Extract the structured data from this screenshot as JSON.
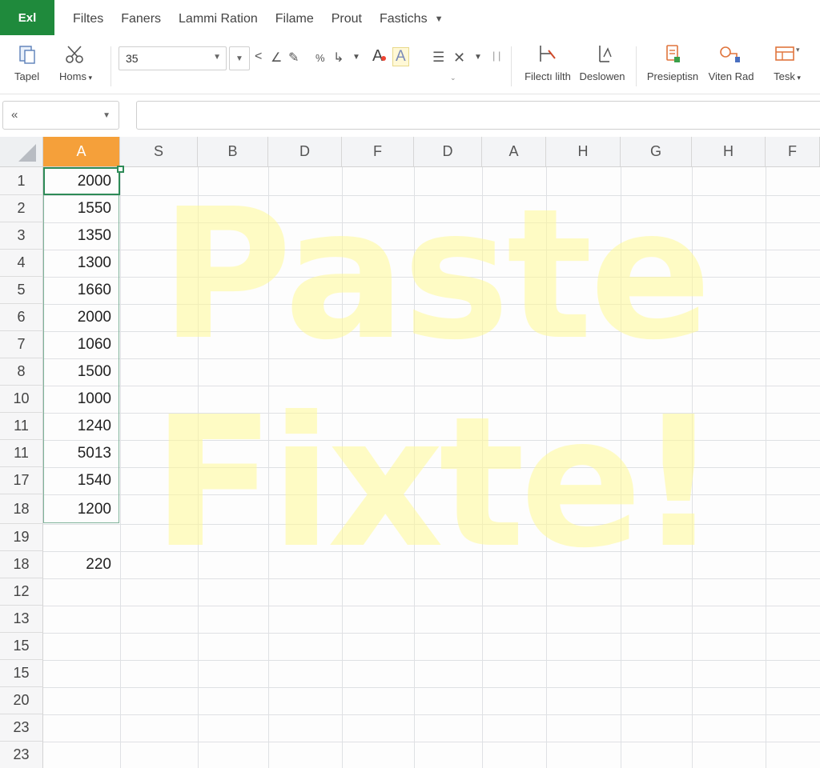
{
  "app": {
    "badge": "Exl"
  },
  "menu": {
    "items": [
      "Filtes",
      "Faners",
      "Lammi Ration",
      "Filame",
      "Prout",
      "Fastichs"
    ]
  },
  "ribbon": {
    "paste_label": "Tapel",
    "home_label": "Homs",
    "font_size": "35",
    "filter_label": "Filectı lilth",
    "deslowen_label": "Deslowen",
    "presiepti_label": "Presiepti",
    "viten_label": "Viten Rad",
    "task_label": "Tesk"
  },
  "namebox": {
    "value": "«"
  },
  "columns": [
    "A",
    "S",
    "B",
    "D",
    "F",
    "D",
    "A",
    "H",
    "G",
    "H",
    "F"
  ],
  "rows": [
    {
      "num": "1",
      "value": "2000"
    },
    {
      "num": "2",
      "value": "1550"
    },
    {
      "num": "3",
      "value": "1350"
    },
    {
      "num": "4",
      "value": "1300"
    },
    {
      "num": "5",
      "value": "1660"
    },
    {
      "num": "6",
      "value": "2000"
    },
    {
      "num": "7",
      "value": "1060"
    },
    {
      "num": "8",
      "value": "1500"
    },
    {
      "num": "10",
      "value": "1000"
    },
    {
      "num": "11",
      "value": "1240"
    },
    {
      "num": "11",
      "value": "5013"
    },
    {
      "num": "17",
      "value": "1540"
    },
    {
      "num": "18",
      "value": "1200"
    },
    {
      "num": "19",
      "value": ""
    },
    {
      "num": "18",
      "value": "220"
    },
    {
      "num": "12",
      "value": ""
    },
    {
      "num": "13",
      "value": ""
    },
    {
      "num": "15",
      "value": ""
    },
    {
      "num": "15",
      "value": ""
    },
    {
      "num": "20",
      "value": ""
    },
    {
      "num": "23",
      "value": ""
    },
    {
      "num": "23",
      "value": ""
    }
  ],
  "overlay": {
    "line1": "Paste",
    "line2": "Fixte!"
  },
  "colors": {
    "app_green": "#1f8a3c",
    "active_column": "#f5a03a",
    "selection": "#2e8b57",
    "overlay": "#fffa96"
  }
}
